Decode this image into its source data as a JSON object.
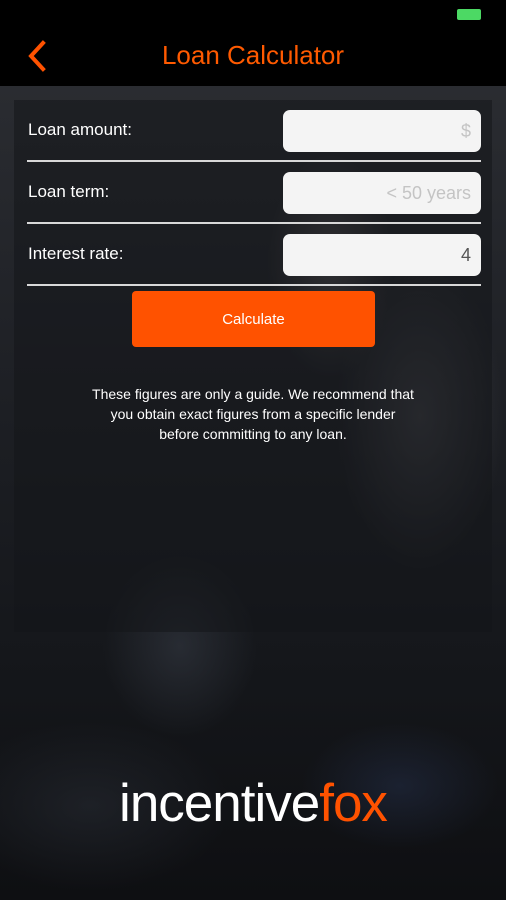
{
  "header": {
    "title": "Loan Calculator",
    "back_icon": "chevron-left-icon"
  },
  "status_bar": {
    "battery_icon": "battery-icon"
  },
  "form": {
    "loan_amount": {
      "label": "Loan amount:",
      "value": "",
      "placeholder": "$"
    },
    "loan_term": {
      "label": "Loan term:",
      "value": "",
      "placeholder": "< 50 years"
    },
    "interest_rate": {
      "label": "Interest rate:",
      "value": "4",
      "placeholder": ""
    }
  },
  "calculate_label": "Calculate",
  "disclaimer_lines": [
    "These figures are only a guide. We recommend that",
    "you obtain exact figures from a specific lender",
    "before committing to any loan."
  ],
  "logo": {
    "part1": "incentive",
    "part2": "fox"
  },
  "colors": {
    "accent": "#ff5200",
    "title": "#ff5a00",
    "battery": "#4cd964",
    "input_bg": "#f4f4f4"
  }
}
